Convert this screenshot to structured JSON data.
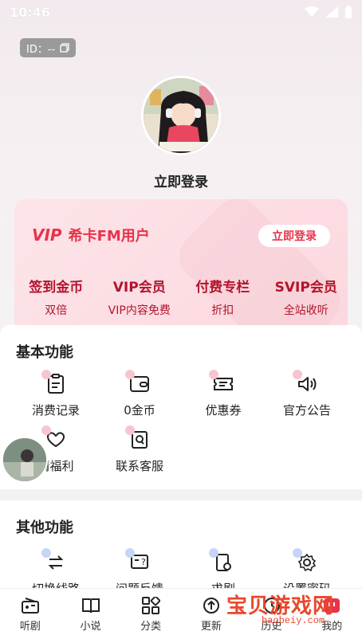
{
  "status_bar": {
    "time": "10:46"
  },
  "profile": {
    "id_label": "ID：--",
    "login_title": "立即登录"
  },
  "vip_card": {
    "logo_text": "VIP",
    "title": "希卡FM用户",
    "login_button": "立即登录",
    "benefits": [
      {
        "title": "签到金币",
        "subtitle": "双倍"
      },
      {
        "title": "VIP会员",
        "subtitle": "VIP内容免费"
      },
      {
        "title": "付费专栏",
        "subtitle": "折扣"
      },
      {
        "title": "SVIP会员",
        "subtitle": "全站收听"
      }
    ]
  },
  "basic_functions": {
    "title": "基本功能",
    "items": [
      {
        "label": "消费记录",
        "icon": "receipt-icon"
      },
      {
        "label": "0金币",
        "icon": "wallet-icon"
      },
      {
        "label": "优惠券",
        "icon": "coupon-icon"
      },
      {
        "label": "官方公告",
        "icon": "speaker-icon"
      },
      {
        "label": "请福利",
        "icon": "heart-hands-icon"
      },
      {
        "label": "联系客服",
        "icon": "support-icon"
      }
    ]
  },
  "other_functions": {
    "title": "其他功能",
    "items": [
      {
        "label": "切换线路",
        "icon": "switch-icon"
      },
      {
        "label": "问题反馈",
        "icon": "feedback-icon"
      },
      {
        "label": "求剧",
        "icon": "request-icon"
      },
      {
        "label": "设置密码",
        "icon": "settings-icon"
      }
    ]
  },
  "tab_bar": {
    "items": [
      {
        "label": "听剧",
        "icon": "radio-icon"
      },
      {
        "label": "小说",
        "icon": "book-icon"
      },
      {
        "label": "分类",
        "icon": "category-icon"
      },
      {
        "label": "更新",
        "icon": "update-icon"
      },
      {
        "label": "历史",
        "icon": "history-icon"
      },
      {
        "label": "我的",
        "icon": "me-icon"
      }
    ]
  },
  "watermark": {
    "text": "宝贝游戏网",
    "url": "baobeiy.com"
  },
  "colors": {
    "accent": "#e8334a",
    "benefit_text": "#b3142c",
    "card_bg": "#fbd8df"
  }
}
